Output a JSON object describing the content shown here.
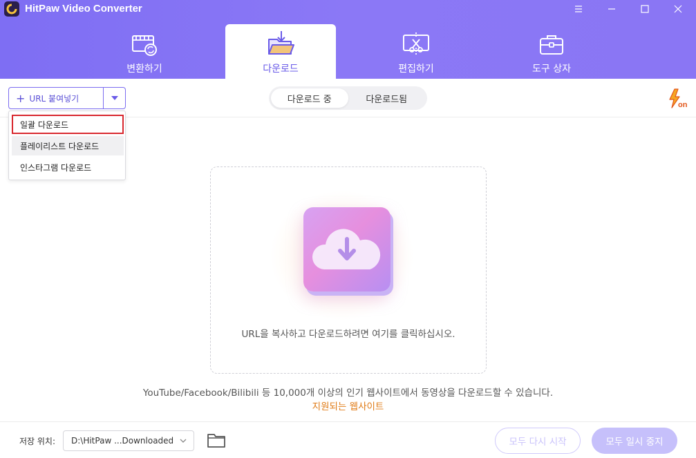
{
  "app": {
    "title": "HitPaw Video Converter"
  },
  "tabs": [
    {
      "label": "변환하기",
      "icon": "film-convert-icon"
    },
    {
      "label": "다운로드",
      "icon": "folder-download-icon"
    },
    {
      "label": "편집하기",
      "icon": "scissors-edit-icon"
    },
    {
      "label": "도구 상자",
      "icon": "toolbox-icon"
    }
  ],
  "toolbar": {
    "url_button_label": "URL 붙여넣기",
    "segment": {
      "downloading": "다운로드 중",
      "downloaded": "다운로드됨"
    }
  },
  "dropdown": {
    "items": [
      "일괄 다운로드",
      "플레이리스트 다운로드",
      "인스타그램 다운로드"
    ]
  },
  "main": {
    "drop_text": "URL을 복사하고 다운로드하려면 여기를 클릭하십시오.",
    "support_text": "YouTube/Facebook/Bilibili 등 10,000개 이상의 인기 웹사이트에서 동영상을 다운로드할 수 있습니다.",
    "support_link": "지원되는 웹사이트"
  },
  "footer": {
    "save_label": "저장 위치:",
    "save_path": "D:\\HitPaw ...Downloaded",
    "restart_all": "모두 다시 시작",
    "pause_all": "모두 일시 중지"
  },
  "colors": {
    "header": "#8b78f6",
    "accent": "#6a5be8",
    "link": "#e07b16",
    "highlight_border": "#d8272e"
  }
}
